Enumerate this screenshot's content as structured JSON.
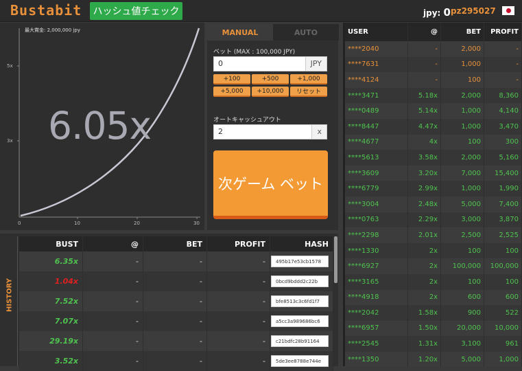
{
  "header": {
    "logo": "Bustabit",
    "hash_check_label": "ハッシュ値チェック",
    "balance_label": "jpy:",
    "balance_value": "0",
    "username": "pz295027",
    "flag": "japan-flag-icon"
  },
  "graph": {
    "max_bet": "最大賞金: 2,000,000 jpy",
    "multiplier": "6.05x",
    "y_ticks": [
      "5x",
      "3x"
    ],
    "x_ticks": [
      "0",
      "10",
      "20",
      "30"
    ]
  },
  "controls": {
    "tab_manual": "MANUAL",
    "tab_auto": "AUTO",
    "bet_label": "ベット (MAX : 100,000 JPY)",
    "bet_value": "0",
    "bet_suffix": "JPY",
    "quick": [
      "+100",
      "+500",
      "+1,000",
      "+5,000",
      "+10,000",
      "リセット"
    ],
    "cashout_label": "オートキャッシュアウト",
    "cashout_value": "2",
    "cashout_suffix": "x",
    "bet_button": "次ゲーム ベット"
  },
  "history": {
    "side_label": "HISTORY",
    "headers": [
      "BUST",
      "@",
      "BET",
      "PROFIT",
      "HASH"
    ],
    "rows": [
      {
        "bust": "6.35x",
        "color": "#4fc34f",
        "at": "-",
        "bet": "-",
        "profit": "-",
        "hash": "495b17e53cb1578"
      },
      {
        "bust": "1.04x",
        "color": "#e02020",
        "at": "-",
        "bet": "-",
        "profit": "-",
        "hash": "0bcd9bddd2c22b"
      },
      {
        "bust": "7.52x",
        "color": "#4fc34f",
        "at": "-",
        "bet": "-",
        "profit": "-",
        "hash": "bfe8513c3c6fd1f7"
      },
      {
        "bust": "7.07x",
        "color": "#4fc34f",
        "at": "-",
        "bet": "-",
        "profit": "-",
        "hash": "a5cc3a989686bc6"
      },
      {
        "bust": "29.19x",
        "color": "#4fc34f",
        "at": "-",
        "bet": "-",
        "profit": "-",
        "hash": "c21bdfc28b91164"
      },
      {
        "bust": "3.52x",
        "color": "#4fc34f",
        "at": "-",
        "bet": "-",
        "profit": "-",
        "hash": "5de3ee8788e744e"
      }
    ]
  },
  "players": {
    "headers": [
      "USER",
      "@",
      "BET",
      "PROFIT"
    ],
    "rows": [
      {
        "user": "****2040",
        "at": "-",
        "bet": "2,000",
        "profit": "-",
        "color": "#e8913a"
      },
      {
        "user": "****7631",
        "at": "-",
        "bet": "1,000",
        "profit": "-",
        "color": "#e8913a"
      },
      {
        "user": "****4124",
        "at": "-",
        "bet": "100",
        "profit": "-",
        "color": "#e8913a"
      },
      {
        "user": "****3471",
        "at": "5.18x",
        "bet": "2,000",
        "profit": "8,360",
        "color": "#4fc34f"
      },
      {
        "user": "****0489",
        "at": "5.14x",
        "bet": "1,000",
        "profit": "4,140",
        "color": "#4fc34f"
      },
      {
        "user": "****8447",
        "at": "4.47x",
        "bet": "1,000",
        "profit": "3,470",
        "color": "#4fc34f"
      },
      {
        "user": "****4677",
        "at": "4x",
        "bet": "100",
        "profit": "300",
        "color": "#4fc34f"
      },
      {
        "user": "****5613",
        "at": "3.58x",
        "bet": "2,000",
        "profit": "5,160",
        "color": "#4fc34f"
      },
      {
        "user": "****3609",
        "at": "3.20x",
        "bet": "7,000",
        "profit": "15,400",
        "color": "#4fc34f"
      },
      {
        "user": "****6779",
        "at": "2.99x",
        "bet": "1,000",
        "profit": "1,990",
        "color": "#4fc34f"
      },
      {
        "user": "****3004",
        "at": "2.48x",
        "bet": "5,000",
        "profit": "7,400",
        "color": "#4fc34f"
      },
      {
        "user": "****0763",
        "at": "2.29x",
        "bet": "3,000",
        "profit": "3,870",
        "color": "#4fc34f"
      },
      {
        "user": "****2298",
        "at": "2.01x",
        "bet": "2,500",
        "profit": "2,525",
        "color": "#4fc34f"
      },
      {
        "user": "****1330",
        "at": "2x",
        "bet": "100",
        "profit": "100",
        "color": "#4fc34f"
      },
      {
        "user": "****6927",
        "at": "2x",
        "bet": "100,000",
        "profit": "100,000",
        "color": "#4fc34f"
      },
      {
        "user": "****3165",
        "at": "2x",
        "bet": "100",
        "profit": "100",
        "color": "#4fc34f"
      },
      {
        "user": "****4918",
        "at": "2x",
        "bet": "600",
        "profit": "600",
        "color": "#4fc34f"
      },
      {
        "user": "****2042",
        "at": "1.58x",
        "bet": "900",
        "profit": "522",
        "color": "#4fc34f"
      },
      {
        "user": "****6957",
        "at": "1.50x",
        "bet": "20,000",
        "profit": "10,000",
        "color": "#4fc34f"
      },
      {
        "user": "****2545",
        "at": "1.31x",
        "bet": "3,100",
        "profit": "961",
        "color": "#4fc34f"
      },
      {
        "user": "****1350",
        "at": "1.20x",
        "bet": "5,000",
        "profit": "1,000",
        "color": "#4fc34f"
      }
    ]
  }
}
